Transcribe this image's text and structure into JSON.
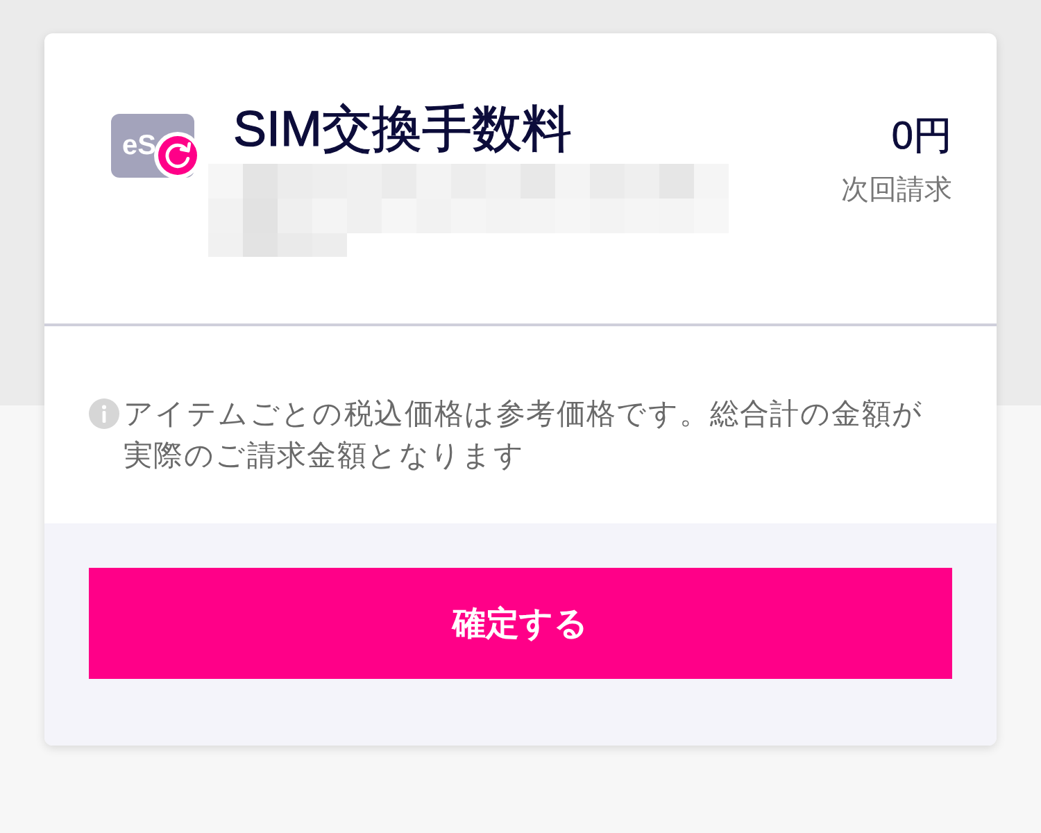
{
  "item": {
    "icon_label": "eS",
    "title": "SIM交換手数料",
    "price": "0円",
    "price_note": "次回請求"
  },
  "notice": {
    "text": "アイテムごとの税込価格は参考価格です。総合計の金額が実際のご請求金額となります"
  },
  "buttons": [
    {
      "label": "確定する"
    }
  ]
}
